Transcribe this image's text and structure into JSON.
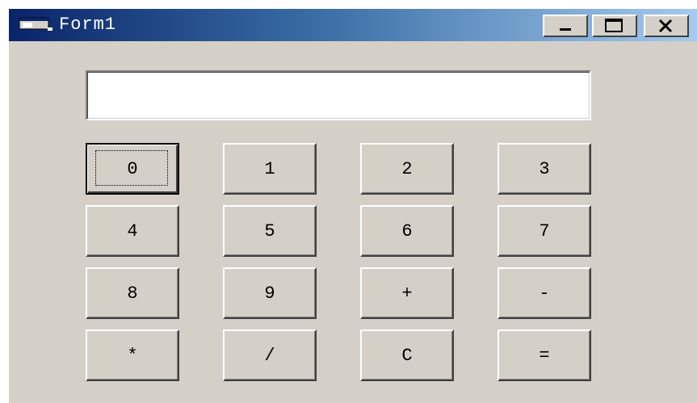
{
  "window": {
    "title": "Form1"
  },
  "display": {
    "value": ""
  },
  "keys": [
    "0",
    "1",
    "2",
    "3",
    "4",
    "5",
    "6",
    "7",
    "8",
    "9",
    "+",
    "-",
    "*",
    "/",
    "C",
    "="
  ],
  "colors": {
    "face": "#d4d0c8",
    "titlebar_start": "#0a246a",
    "titlebar_end": "#a6caf0"
  }
}
